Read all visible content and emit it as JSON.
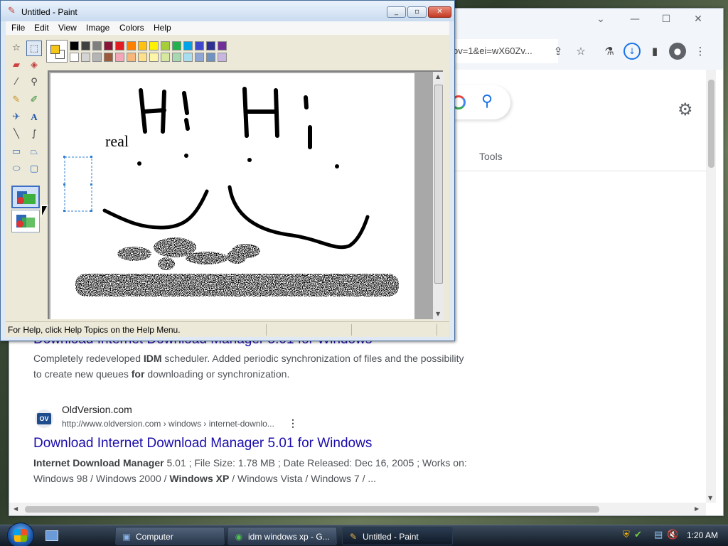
{
  "paint": {
    "title": "Untitled - Paint",
    "menu": [
      "File",
      "Edit",
      "View",
      "Image",
      "Colors",
      "Help"
    ],
    "status": "For Help, click Help Topics on the Help Menu.",
    "canvas_text": "real",
    "foreground_color": "#f5c518",
    "palette_top": [
      "#000000",
      "#404040",
      "#7f7f7f",
      "#8b1538",
      "#e31b23",
      "#ff7f00",
      "#ffc20e",
      "#fff200",
      "#a6ce39",
      "#22b14c",
      "#00a2e8",
      "#3f48cc",
      "#2e3192",
      "#6f3198"
    ],
    "palette_bottom": [
      "#ffffff",
      "#d4d4d4",
      "#b5b5b5",
      "#9c5a3c",
      "#f4a6b8",
      "#f7b77a",
      "#ffe08a",
      "#fff5a8",
      "#d6e8a0",
      "#a8d8b0",
      "#a8dcef",
      "#8ea6d6",
      "#7092be",
      "#c8b6e0"
    ]
  },
  "chrome": {
    "url": "ov=1&ei=wX60Zv...",
    "tools_label": "Tools",
    "result1": {
      "title_partial": "Download Internet Download Manager 5.01 for Windows",
      "snippet_line1_a": "Completely redeveloped ",
      "snippet_line1_b": "IDM",
      "snippet_line1_c": " scheduler. Added periodic synchronization of files and the possibility",
      "snippet_line2_a": "to create new queues ",
      "snippet_line2_b": "for",
      "snippet_line2_c": " downloading or synchronization."
    },
    "result2": {
      "favicon_text": "OV",
      "site_name": "OldVersion.com",
      "site_url": "http://www.oldversion.com › windows › internet-downlo...",
      "title": "Download Internet Download Manager 5.01 for Windows",
      "snippet_line1_a": "Internet Download Manager",
      "snippet_line1_b": " 5.01 ; File Size: 1.78 MB ; Date Released: Dec 16, 2005 ; Works on:",
      "snippet_line2_a": "Windows 98 / Windows 2000 / ",
      "snippet_line2_b": "Windows XP",
      "snippet_line2_c": " / Windows Vista / Windows 7 / ..."
    }
  },
  "taskbar": {
    "buttons": [
      {
        "label": "Computer",
        "icon": "computer-icon"
      },
      {
        "label": "idm windows xp - G...",
        "icon": "chrome-icon"
      },
      {
        "label": "Untitled - Paint",
        "icon": "paint-icon"
      }
    ],
    "clock": "1:20 AM"
  }
}
